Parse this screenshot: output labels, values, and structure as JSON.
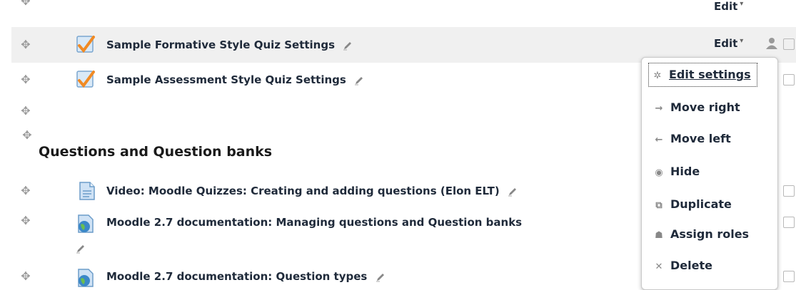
{
  "top_row": {
    "edit_label": "Edit"
  },
  "activities": [
    {
      "title": "Sample Formative Style Quiz Settings",
      "type_icon": "quiz-check-icon",
      "edit_label": "Edit"
    },
    {
      "title": "Sample Assessment Style Quiz Settings",
      "type_icon": "quiz-check-icon"
    }
  ],
  "section": {
    "title": "Questions and Question banks"
  },
  "resources": [
    {
      "title": "Video: Moodle Quizzes: Creating and adding questions (Elon ELT)",
      "type_icon": "page-icon"
    },
    {
      "title": "Moodle 2.7 documentation: Managing questions and Question banks",
      "type_icon": "url-globe-icon"
    },
    {
      "title": "Moodle 2.7 documentation: Question types",
      "type_icon": "url-globe-icon"
    }
  ],
  "menu": {
    "items": [
      {
        "label": "Edit settings",
        "icon": "gear-icon",
        "glyph": "✲"
      },
      {
        "label": "Move right",
        "icon": "arrow-right-icon",
        "glyph": "→"
      },
      {
        "label": "Move left",
        "icon": "arrow-left-icon",
        "glyph": "←"
      },
      {
        "label": "Hide",
        "icon": "eye-icon",
        "glyph": "◉"
      },
      {
        "label": "Duplicate",
        "icon": "duplicate-icon",
        "glyph": "⧉"
      },
      {
        "label": "Assign roles",
        "icon": "user-plus-icon",
        "glyph": "☗"
      },
      {
        "label": "Delete",
        "icon": "close-icon",
        "glyph": "✕"
      }
    ]
  },
  "colors": {
    "accent_check": "#f08a24",
    "title": "#1f2a3a",
    "highlight": "#f0f0f0"
  }
}
